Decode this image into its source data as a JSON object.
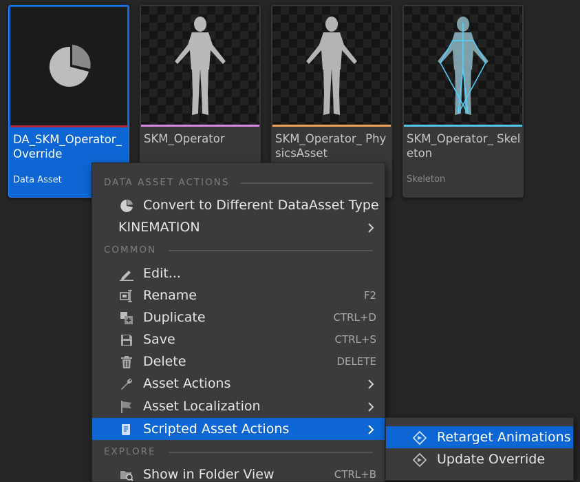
{
  "assets": [
    {
      "name": "DA_SKM_Operator_ Override",
      "type": "Data Asset",
      "stripe_color": "#b6243a",
      "thumbnail": "pie-chart-icon",
      "selected": true
    },
    {
      "name": "SKM_Operator",
      "type": "",
      "stripe_color": "#d68be0",
      "thumbnail": "skeletal-mesh-figure"
    },
    {
      "name": "SKM_Operator_ PhysicsAsset",
      "type": "",
      "stripe_color": "#f0a35a",
      "thumbnail": "physics-asset-figure"
    },
    {
      "name": "SKM_Operator_ Skeleton",
      "type": "Skeleton",
      "stripe_color": "#56c6e6",
      "thumbnail": "skeleton-figure"
    }
  ],
  "context_menu": {
    "sections": {
      "data_asset_actions": "DATA ASSET ACTIONS",
      "common": "COMMON",
      "explore": "EXPLORE"
    },
    "items": {
      "convert": {
        "label": "Convert to Different DataAsset Type",
        "icon": "pie-chart-icon"
      },
      "kinemation": {
        "label": "KINEMATION",
        "submenu": true
      },
      "edit": {
        "label": "Edit...",
        "icon": "pencil-icon"
      },
      "rename": {
        "label": "Rename",
        "shortcut": "F2",
        "icon": "rename-icon"
      },
      "duplicate": {
        "label": "Duplicate",
        "shortcut": "CTRL+D",
        "icon": "duplicate-icon"
      },
      "save": {
        "label": "Save",
        "shortcut": "CTRL+S",
        "icon": "save-icon"
      },
      "delete": {
        "label": "Delete",
        "shortcut": "DELETE",
        "icon": "trash-icon"
      },
      "asset_actions": {
        "label": "Asset Actions",
        "submenu": true,
        "icon": "wrench-icon"
      },
      "asset_localization": {
        "label": "Asset Localization",
        "submenu": true,
        "icon": "flag-icon"
      },
      "scripted_asset_actions": {
        "label": "Scripted Asset Actions",
        "submenu": true,
        "highlighted": true,
        "icon": "script-icon"
      },
      "show_in_folder": {
        "label": "Show in Folder View",
        "shortcut": "CTRL+B",
        "icon": "folder-search-icon"
      }
    }
  },
  "submenu": {
    "items": [
      {
        "label": "Retarget Animations",
        "icon": "blueprint-function-icon",
        "highlighted": true
      },
      {
        "label": "Update Override",
        "icon": "blueprint-function-icon"
      }
    ]
  },
  "colors": {
    "accent": "#0d66d4",
    "background": "#262626",
    "menu": "#3b3b3b"
  }
}
